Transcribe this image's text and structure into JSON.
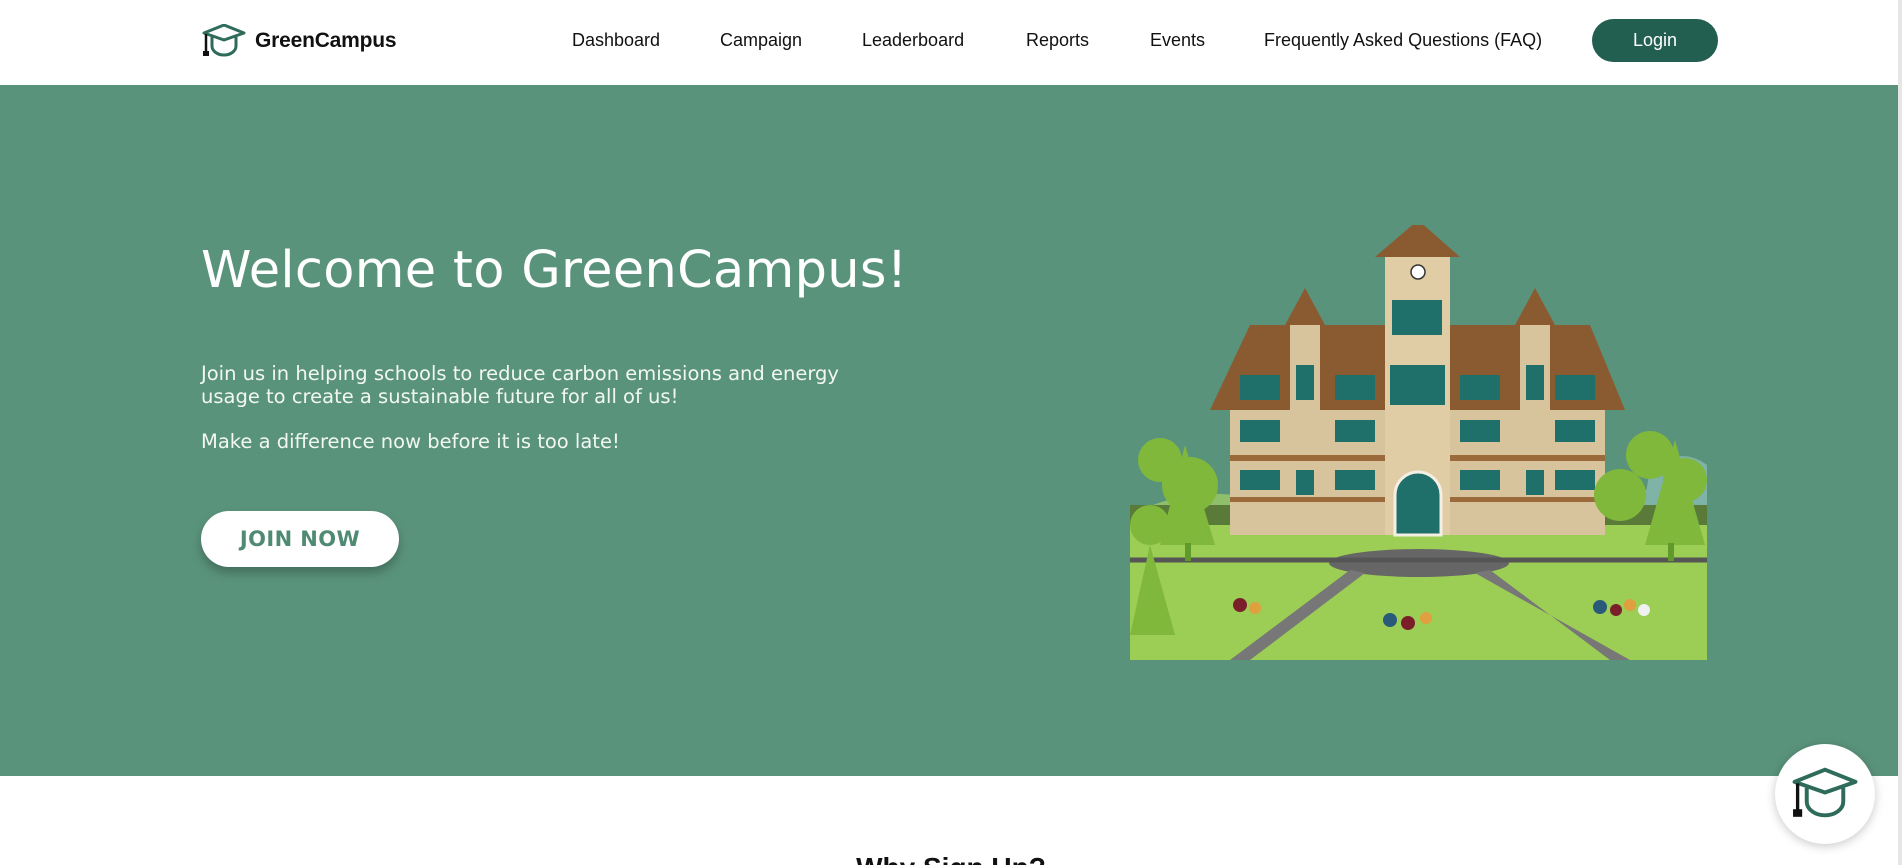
{
  "brand": {
    "name": "GreenCampus",
    "logo_icon": "graduation-cap-icon"
  },
  "nav": {
    "items": [
      "Dashboard",
      "Campaign",
      "Leaderboard",
      "Reports",
      "Events",
      "Frequently Asked Questions (FAQ)"
    ],
    "login_label": "Login"
  },
  "hero": {
    "title": "Welcome to GreenCampus!",
    "paragraph": "Join us in helping schools to reduce carbon emissions and energy usage to create a sustainable future for all of us!",
    "tagline": "Make a difference now before it is too late!",
    "cta_label": "JOIN NOW"
  },
  "next_section": {
    "title": "Why Sign Up?"
  },
  "chat_fab": {
    "icon": "graduation-cap-icon"
  },
  "colors": {
    "hero_bg": "#5a937c",
    "primary_dark": "#235f50",
    "cta_text": "#4f8a72"
  }
}
